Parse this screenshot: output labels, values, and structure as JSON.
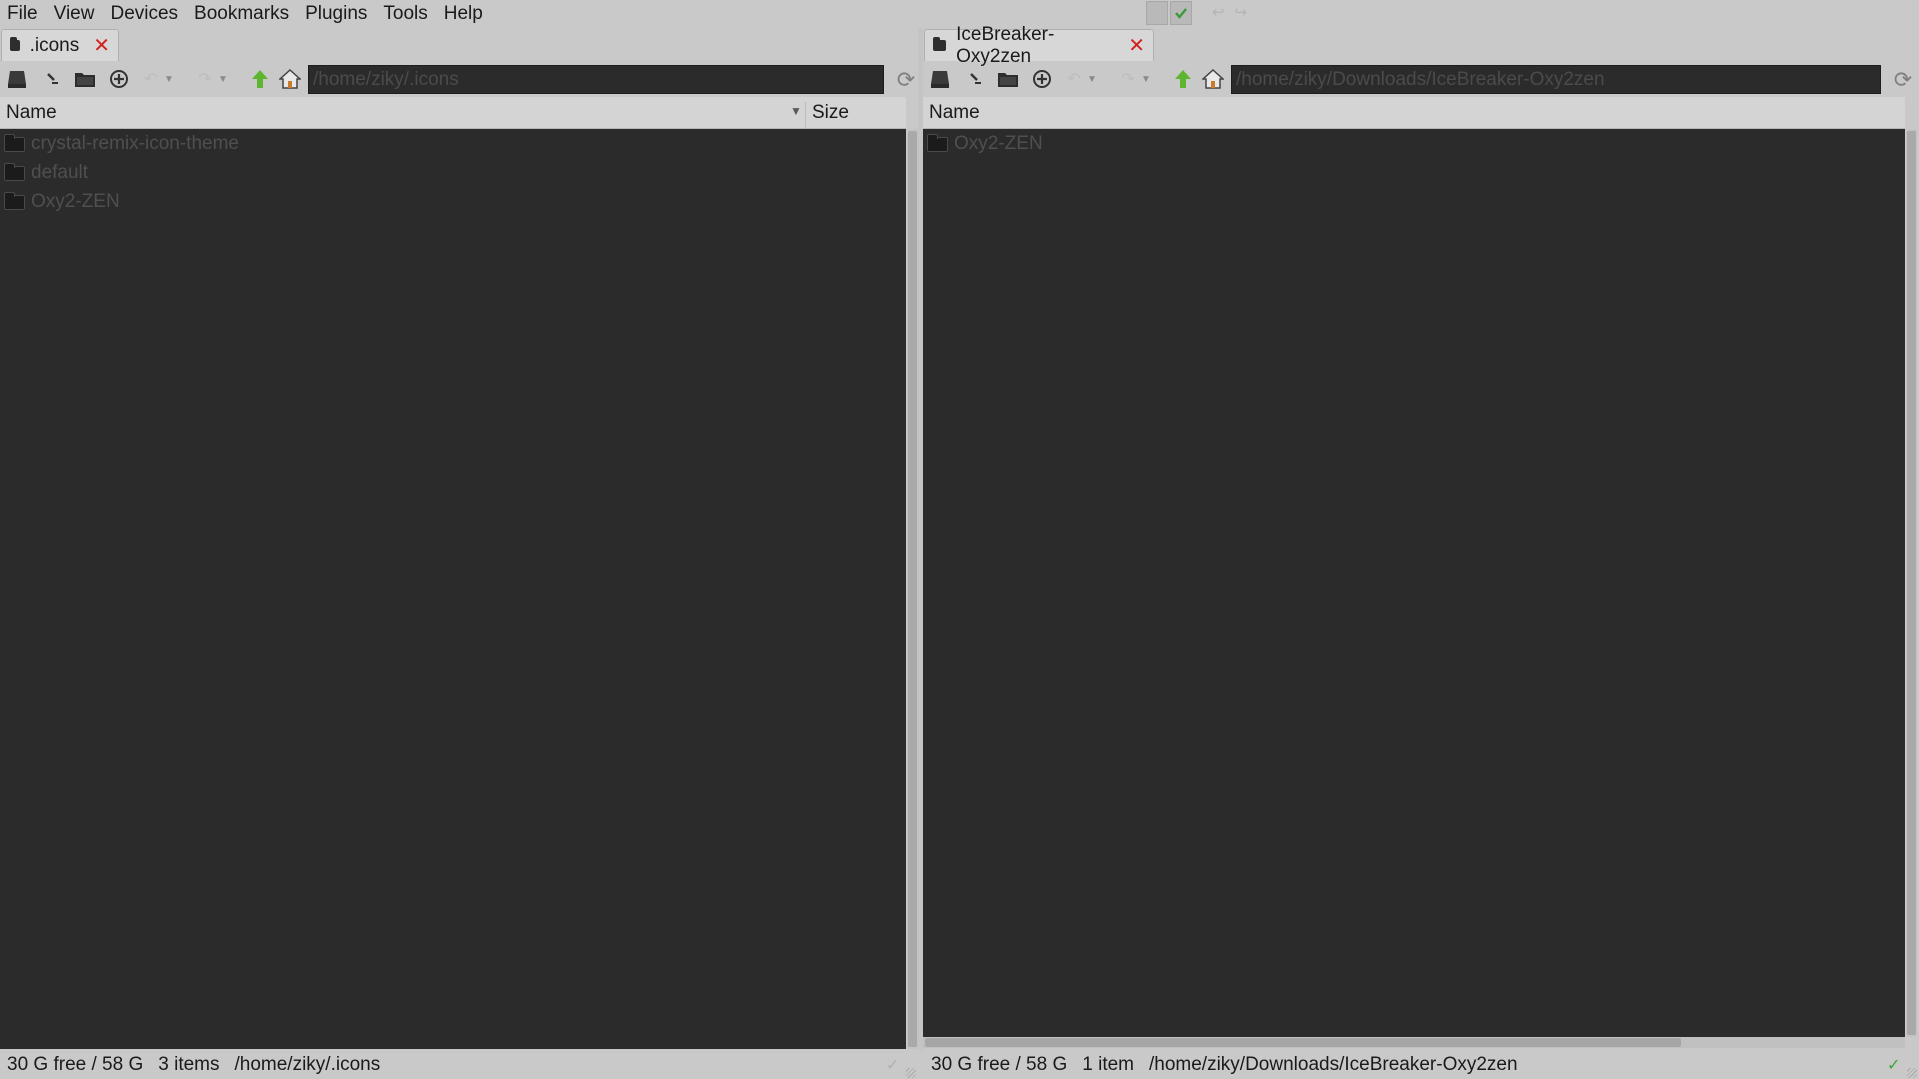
{
  "menubar": {
    "items": [
      "File",
      "View",
      "Devices",
      "Bookmarks",
      "Plugins",
      "Tools",
      "Help"
    ]
  },
  "tray": {
    "icons": [
      "blank-tray-icon",
      "check-tray-icon",
      "faded-arrows-icon"
    ]
  },
  "left_pane": {
    "tab_label": ".icons",
    "path": "/home/ziky/.icons",
    "columns": {
      "name": "Name",
      "size": "Size"
    },
    "entries": [
      "crystal-remix-icon-theme",
      "default",
      "Oxy2-ZEN"
    ],
    "status": {
      "free": "30 G free / 58 G",
      "count": "3 items",
      "path": "/home/ziky/.icons"
    }
  },
  "right_pane": {
    "tab_label": "IceBreaker-Oxy2zen",
    "path": "/home/ziky/Downloads/IceBreaker-Oxy2zen",
    "columns": {
      "name": "Name"
    },
    "entries": [
      "Oxy2-ZEN"
    ],
    "status": {
      "free": "30 G free / 58 G",
      "count": "1 item",
      "path": "/home/ziky/Downloads/IceBreaker-Oxy2zen"
    }
  },
  "colors": {
    "list_bg": "#2b2b2b",
    "chrome_bg": "#c9c9c9",
    "close_red": "#d51f1f",
    "up_green": "#5fb52f",
    "status_green": "#3aa53a"
  }
}
